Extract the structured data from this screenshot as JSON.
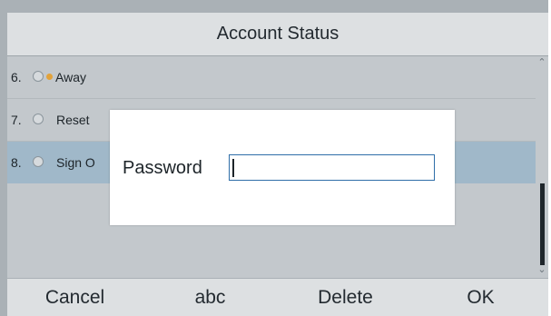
{
  "screen": {
    "title": "Account Status"
  },
  "list": {
    "items": [
      {
        "number": "6.",
        "label": "Away",
        "has_status_dot": true,
        "status_color": "#e2a23a"
      },
      {
        "number": "7.",
        "label": "Reset",
        "has_status_dot": false
      },
      {
        "number": "8.",
        "label": "Sign O",
        "has_status_dot": false,
        "selected": true
      },
      {
        "number": "",
        "label": "",
        "has_status_dot": false
      }
    ]
  },
  "dialog": {
    "label": "Password",
    "input_value": ""
  },
  "softkeys": {
    "cancel": "Cancel",
    "abc": "abc",
    "delete": "Delete",
    "ok": "OK"
  },
  "scrollbar": {
    "up_icon": "chevron-up-icon",
    "down_icon": "chevron-down-icon"
  },
  "colors": {
    "selected_row": "#a0b8c9",
    "input_border": "#2f6ea8",
    "away_dot": "#e2a23a"
  }
}
